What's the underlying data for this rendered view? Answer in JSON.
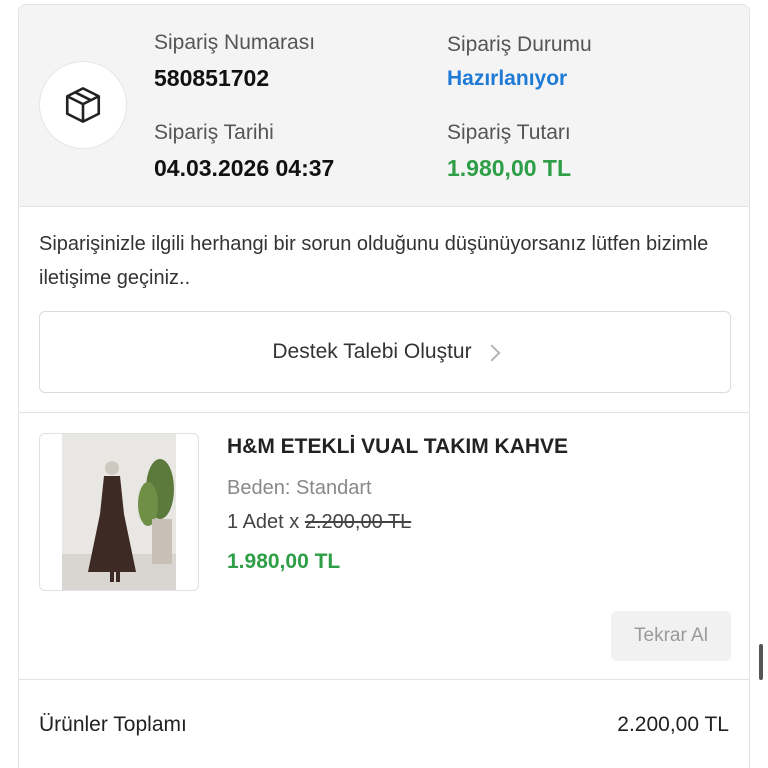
{
  "order": {
    "number_label": "Sipariş Numarası",
    "number_value": "580851702",
    "status_label": "Sipariş Durumu",
    "status_value": "Hazırlanıyor",
    "date_label": "Sipariş Tarihi",
    "date_value": "04.03.2026 04:37",
    "total_label": "Sipariş Tutarı",
    "total_value": "1.980,00 TL",
    "icon": "package-box-icon"
  },
  "notice": {
    "text": "Siparişinizle ilgili herhangi bir sorun olduğunu düşünüyorsanız lütfen bizimle iletişime geçiniz..",
    "support_button": "Destek Talebi Oluştur"
  },
  "product": {
    "title": "H&M ETEKLİ VUAL TAKIM KAHVE",
    "size": "Beden: Standart",
    "qty_prefix": "1 Adet",
    "qty_x": "x",
    "old_price": "2.200,00 TL",
    "price": "1.980,00 TL",
    "reorder_button": "Tekrar Al"
  },
  "summary": {
    "products_total_label": "Ürünler Toplamı",
    "products_total_value": "2.200,00 TL"
  },
  "colors": {
    "status_blue": "#1f7ad6",
    "price_green": "#2e9e47"
  }
}
